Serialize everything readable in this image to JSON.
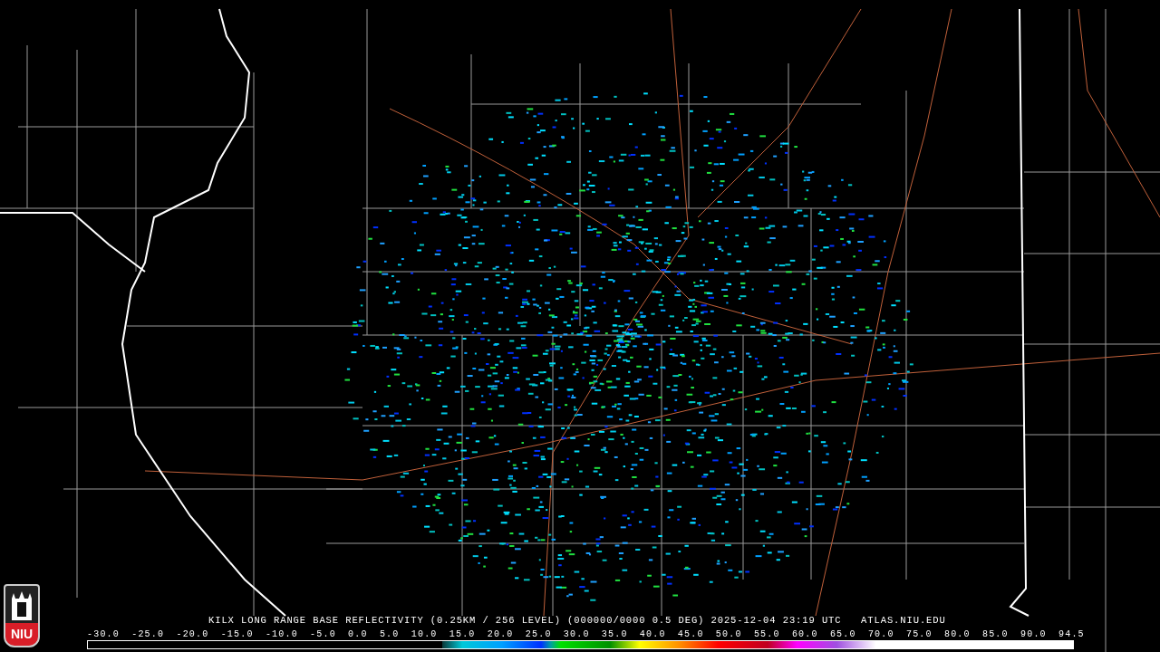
{
  "logo": {
    "text": "NIU"
  },
  "caption": {
    "text": "KILX LONG RANGE BASE REFLECTIVITY (0.25KM / 256 LEVEL) (000000/0000 0.5 DEG) 2025-12-04 23:19 UTC   ATLAS.NIU.EDU"
  },
  "legend": {
    "ticks": [
      "-30.0",
      "-25.0",
      "-20.0",
      "-15.0",
      "-10.0",
      "-5.0",
      "0.0",
      "5.0",
      "10.0",
      "15.0",
      "20.0",
      "25.0",
      "30.0",
      "35.0",
      "40.0",
      "45.0",
      "50.0",
      "55.0",
      "60.0",
      "65.0",
      "70.0",
      "75.0",
      "80.0",
      "85.0",
      "90.0",
      "94.5"
    ]
  }
}
